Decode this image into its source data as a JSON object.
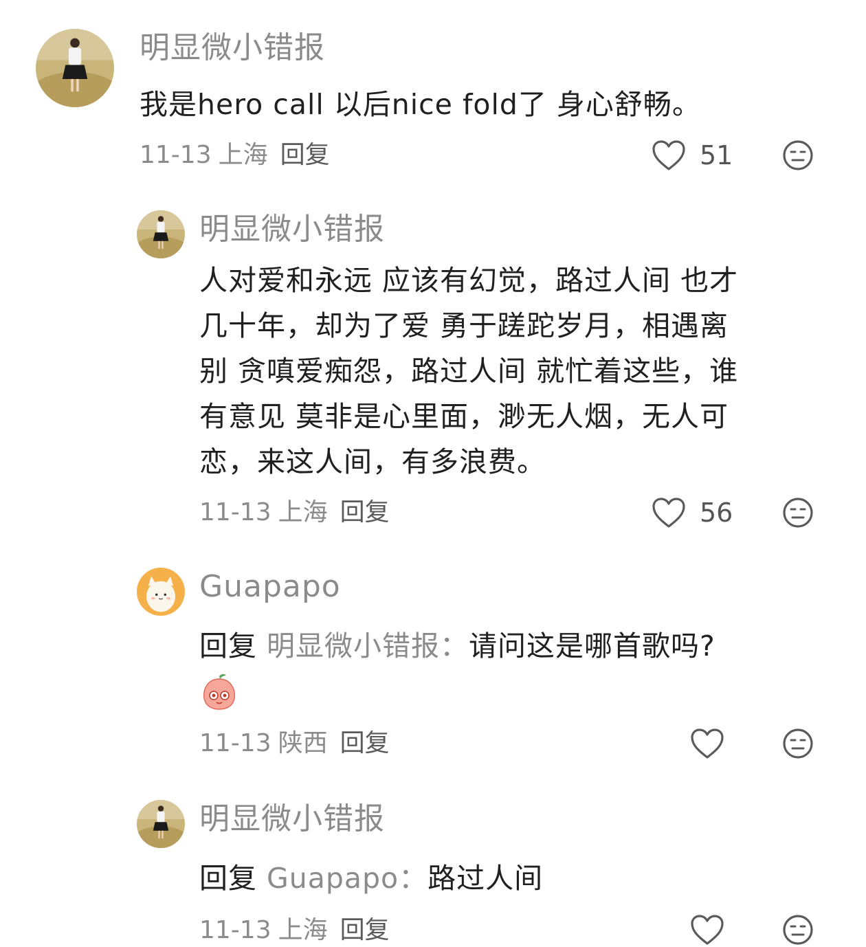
{
  "comments": [
    {
      "username": "明显微小错报",
      "text": "我是hero call 以后nice fold了 身心舒畅。",
      "date": "11-13",
      "location": "上海",
      "reply_label": "回复",
      "likes": "51",
      "like_icon": "heart-outline-icon",
      "dislike_icon": "neutral-face-icon"
    },
    {
      "username": "明显微小错报",
      "lines": [
        "人对爱和永远 应该有幻觉，路过人间 也才",
        "几十年，却为了爱 勇于蹉跎岁月，相遇离",
        "别 贪嗔爱痴怨，路过人间 就忙着这些，谁",
        "有意见 莫非是心里面，渺无人烟，无人可",
        "恋，来这人间，有多浪费。"
      ],
      "date": "11-13",
      "location": "上海",
      "reply_label": "回复",
      "likes": "56"
    },
    {
      "username": "Guapapo",
      "reply_prefix": "回复",
      "reply_target": "明显微小错报",
      "reply_colon": "：",
      "reply_text": "请问这是哪首歌吗?",
      "emoji_icon": "peach-face-emoji-icon",
      "date": "11-13",
      "location": "陕西",
      "reply_label": "回复"
    },
    {
      "username": "明显微小错报",
      "reply_prefix": "回复",
      "reply_target": "Guapapo",
      "reply_colon": "：",
      "reply_text": "路过人间",
      "date": "11-13",
      "location": "上海",
      "reply_label": "回复"
    }
  ],
  "colors": {
    "username": "#8b8b8b",
    "text": "#202020",
    "meta": "#8b8b8b",
    "icon": "#5a5a5a",
    "avatar_bg_field": "#b8a46a"
  }
}
